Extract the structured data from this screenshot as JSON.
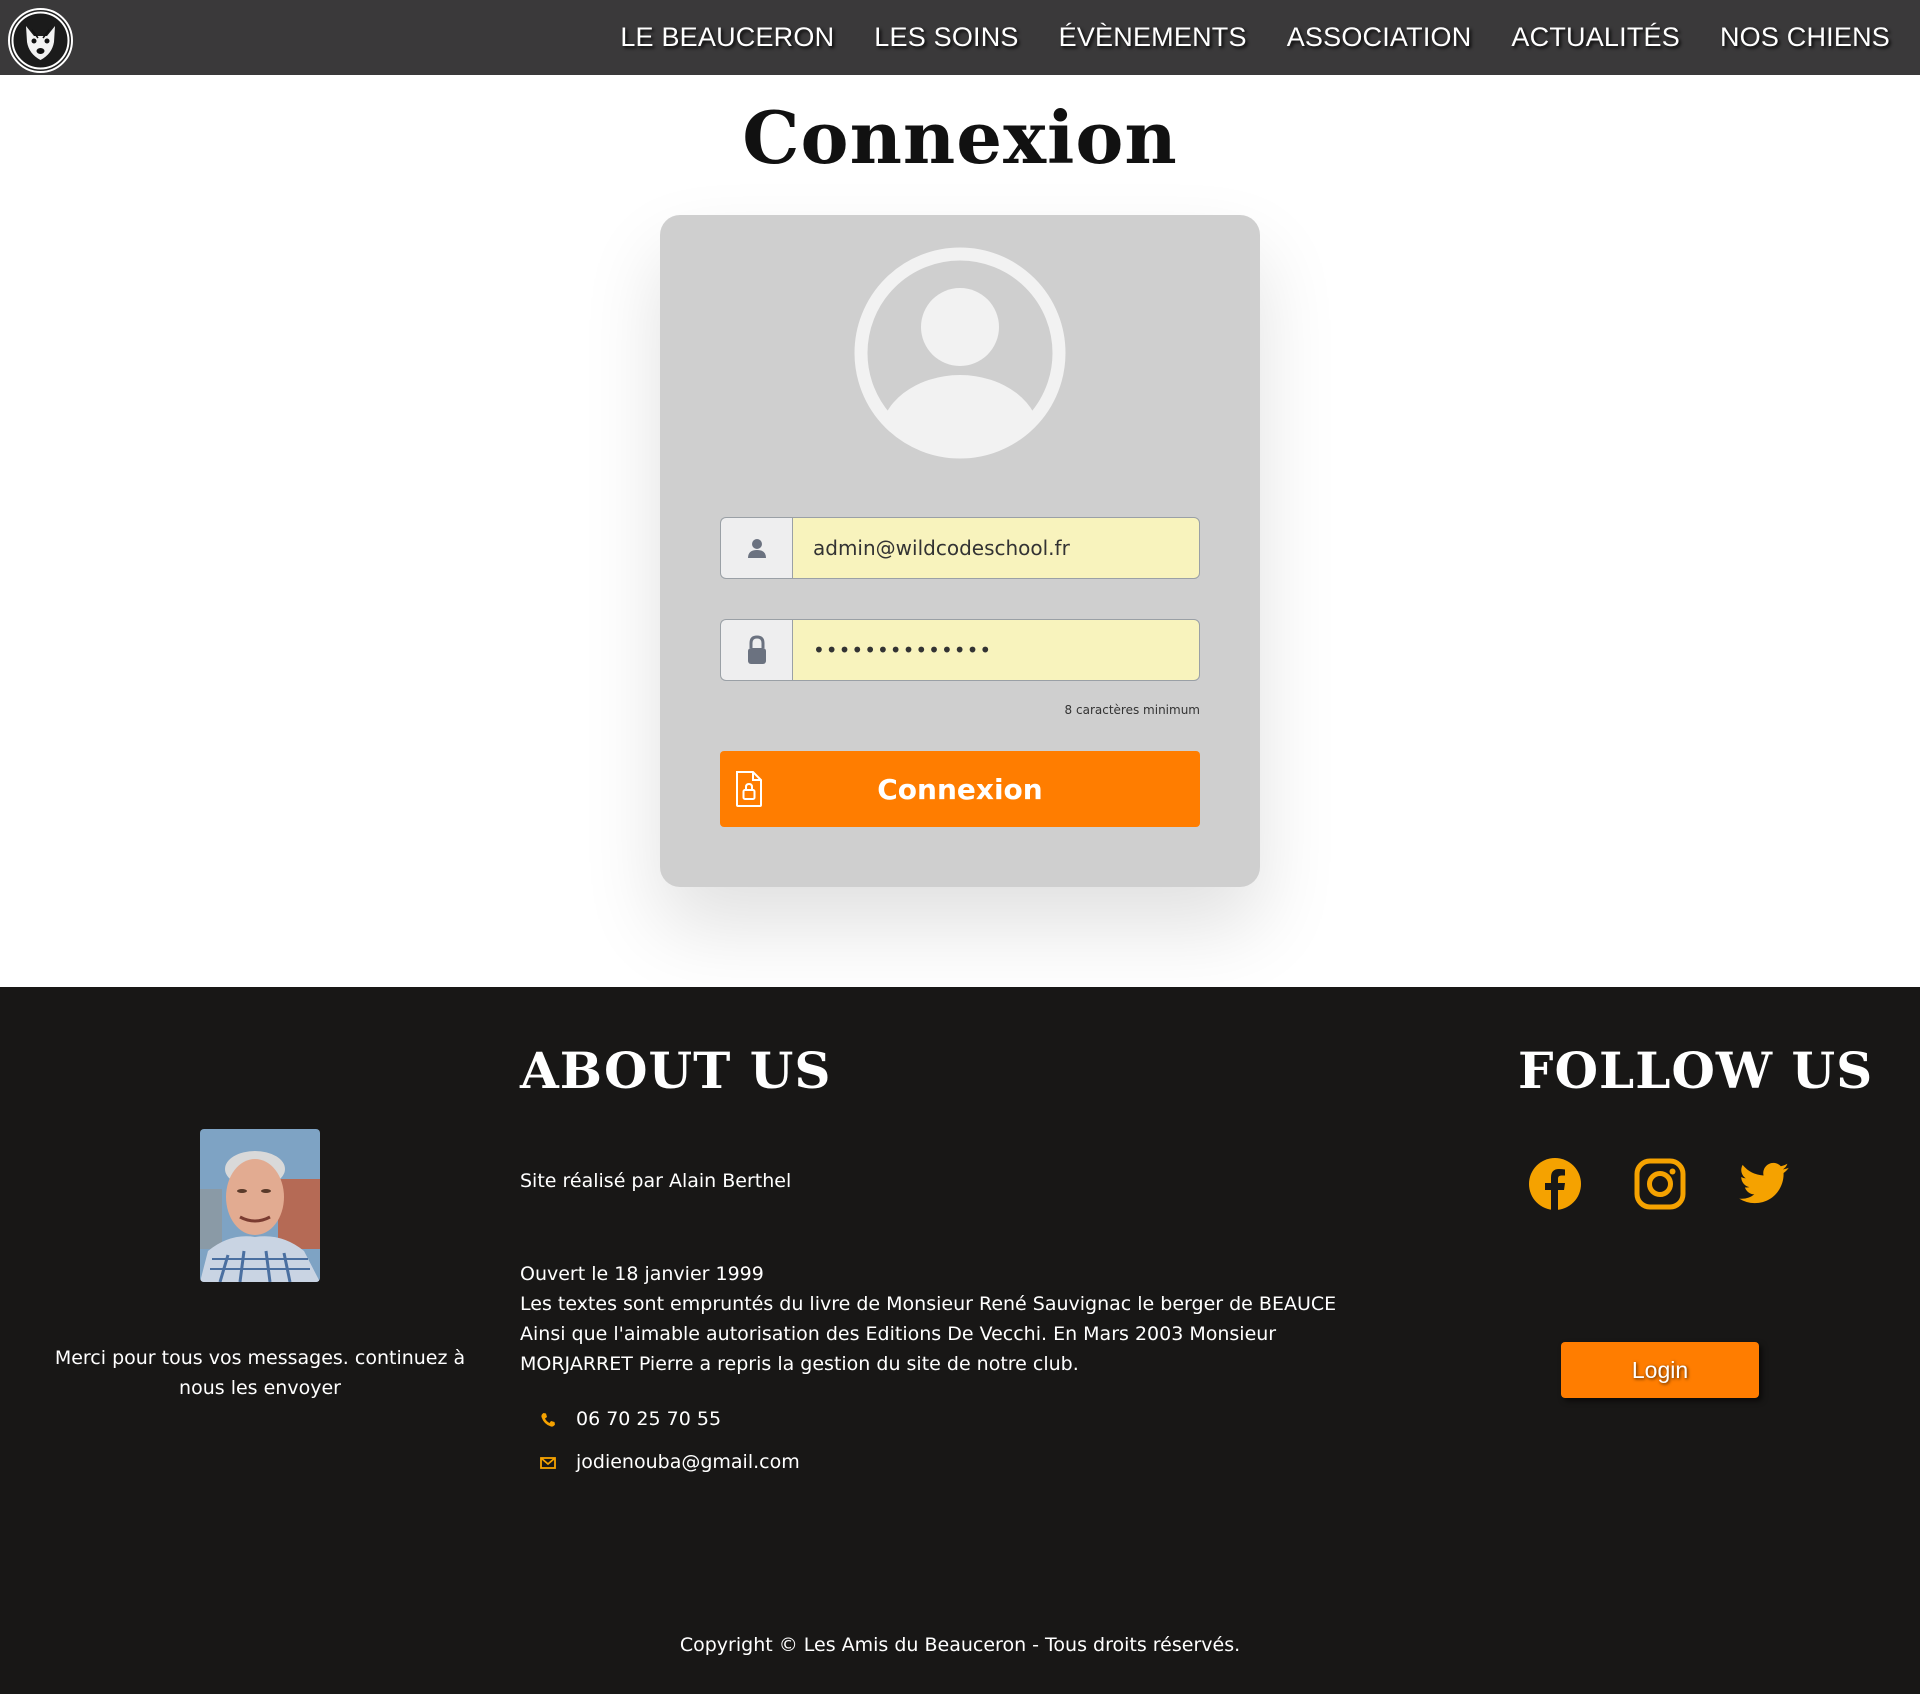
{
  "nav": {
    "logo_icon": "beauceron-dog-logo",
    "items": [
      {
        "label": "LE BEAUCERON"
      },
      {
        "label": "LES SOINS"
      },
      {
        "label": "ÉVÈNEMENTS"
      },
      {
        "label": "ASSOCIATION"
      },
      {
        "label": "ACTUALITÉS"
      },
      {
        "label": "NOS CHIENS"
      }
    ]
  },
  "login": {
    "title": "Connexion",
    "avatar_icon": "user-avatar-icon",
    "email_value": "admin@wildcodeschool.fr",
    "password_value": "••••••••••••••",
    "password_hint": "8 caractères minimum",
    "submit_label": "Connexion"
  },
  "footer": {
    "thanks": "Merci pour tous vos messages. continuez à nous les envoyer",
    "about_title": "ABOUT US",
    "credit": "Site réalisé par Alain Berthel",
    "about_lines": [
      "Ouvert le 18 janvier 1999",
      "Les textes sont empruntés du livre de Monsieur René Sauvignac le berger de BEAUCE",
      "Ainsi que l'aimable autorisation des Editions De Vecchi. En Mars 2003 Monsieur MORJARRET Pierre a repris la gestion du site de notre club."
    ],
    "phone": "06 70 25 70 55",
    "email": "jodienouba@gmail.com",
    "follow_title": "FOLLOW US",
    "social": [
      "facebook-icon",
      "instagram-icon",
      "twitter-icon"
    ],
    "login_label": "Login",
    "copyright": "Copyright © Les Amis du Beauceron - Tous droits réservés."
  },
  "colors": {
    "accent": "#ff7d00",
    "nav_bg": "#3a393a",
    "footer_bg": "#181716",
    "card_bg": "#cfcfcf",
    "input_bg": "#f8f3bd",
    "social_icon": "#f5a200"
  }
}
